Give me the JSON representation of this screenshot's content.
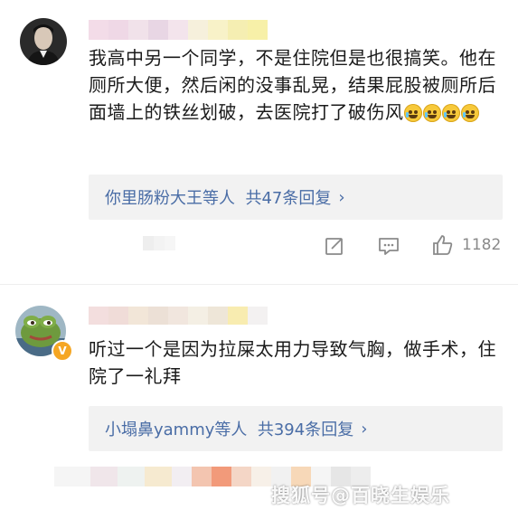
{
  "comments": [
    {
      "text": "我高中另一个同学，不是住院但是也很搞笑。他在厕所大便，然后闲的没事乱晃，结果屁股被厕所后面墙上的铁丝划破，去医院打了破伤风",
      "emoji_icons": [
        "laugh-cry-emoji",
        "laugh-cry-emoji",
        "laugh-cry-emoji",
        "laugh-cry-emoji"
      ],
      "replies_summary": "你里肠粉大王等人  共47条回复",
      "actions": {
        "share_icon": "share-icon",
        "comment_icon": "comment-icon",
        "like_icon": "thumbs-up-icon",
        "like_count": "1182"
      }
    },
    {
      "text": "听过一个是因为拉屎太用力导致气胸，做手术，住院了一礼拜",
      "replies_summary": "小塌鼻yammy等人  共394条回复",
      "watermark": "搜狐号@百晓生娱乐"
    }
  ],
  "colors": {
    "reply_link": "#4a6da6",
    "reply_bg": "#f2f2f2",
    "icon_grey": "#8a8a8a",
    "verified_badge": "#f5a623"
  }
}
